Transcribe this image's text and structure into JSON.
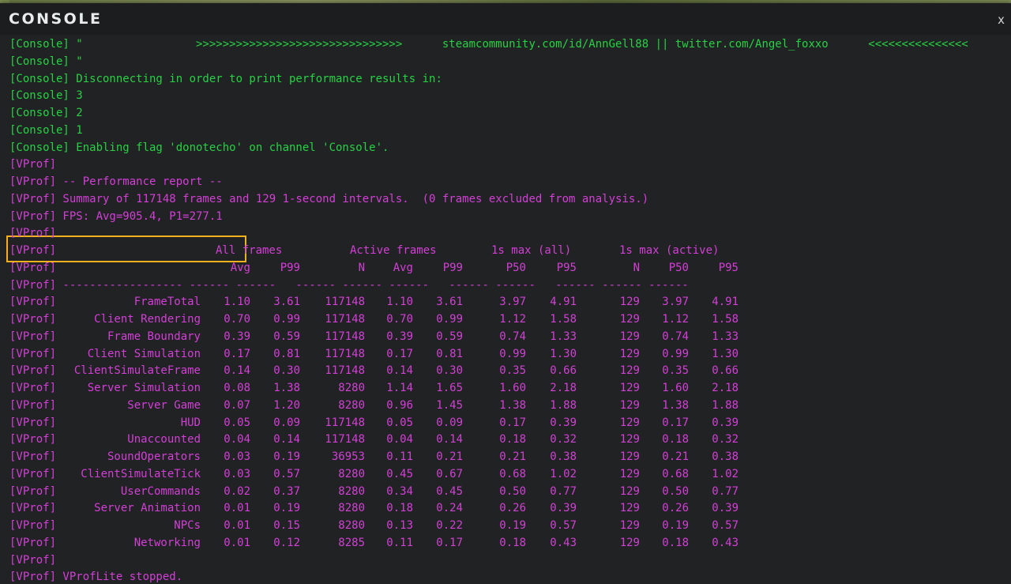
{
  "window": {
    "title": "CONSOLE",
    "close_label": "x"
  },
  "green_lines": [
    "[Console] \"                 >>>>>>>>>>>>>>>>>>>>>>>>>>>>>>>      steamcommunity.com/id/AnnGell88 || twitter.com/Angel_foxxo      <<<<<<<<<<<<<<<",
    "[Console] \"",
    "[Console] Disconnecting in order to print performance results in:",
    "[Console] 3",
    "[Console] 2",
    "[Console] 1",
    "[Console] Enabling flag 'donotecho' on channel 'Console'."
  ],
  "vprof_prefix": "[VProf]",
  "report_header": "[VProf] -- Performance report --",
  "summary_line": "[VProf] Summary of 117148 frames and 129 1-second intervals.  (0 frames excluded from analysis.)",
  "fps_line": "[VProf] FPS: Avg=905.4, P1=277.1",
  "group_headers": [
    "All frames",
    "Active frames",
    "1s max (all)",
    "1s max (active)"
  ],
  "column_headers": [
    "Avg",
    "P99",
    "N",
    "Avg",
    "P99",
    "P50",
    "P95",
    "N",
    "P50",
    "P95"
  ],
  "separator_line": "[VProf] ------------------ ------ ------   ------ ------ ------   ------ ------   ------ ------ ------",
  "rows": [
    {
      "name": "FrameTotal",
      "v": [
        "1.10",
        "3.61",
        "117148",
        "1.10",
        "3.61",
        "3.97",
        "4.91",
        "129",
        "3.97",
        "4.91"
      ]
    },
    {
      "name": "Client Rendering",
      "v": [
        "0.70",
        "0.99",
        "117148",
        "0.70",
        "0.99",
        "1.12",
        "1.58",
        "129",
        "1.12",
        "1.58"
      ]
    },
    {
      "name": "Frame Boundary",
      "v": [
        "0.39",
        "0.59",
        "117148",
        "0.39",
        "0.59",
        "0.74",
        "1.33",
        "129",
        "0.74",
        "1.33"
      ]
    },
    {
      "name": "Client Simulation",
      "v": [
        "0.17",
        "0.81",
        "117148",
        "0.17",
        "0.81",
        "0.99",
        "1.30",
        "129",
        "0.99",
        "1.30"
      ]
    },
    {
      "name": "ClientSimulateFrame",
      "v": [
        "0.14",
        "0.30",
        "117148",
        "0.14",
        "0.30",
        "0.35",
        "0.66",
        "129",
        "0.35",
        "0.66"
      ]
    },
    {
      "name": "Server Simulation",
      "v": [
        "0.08",
        "1.38",
        "8280",
        "1.14",
        "1.65",
        "1.60",
        "2.18",
        "129",
        "1.60",
        "2.18"
      ]
    },
    {
      "name": "Server Game",
      "v": [
        "0.07",
        "1.20",
        "8280",
        "0.96",
        "1.45",
        "1.38",
        "1.88",
        "129",
        "1.38",
        "1.88"
      ]
    },
    {
      "name": "HUD",
      "v": [
        "0.05",
        "0.09",
        "117148",
        "0.05",
        "0.09",
        "0.17",
        "0.39",
        "129",
        "0.17",
        "0.39"
      ]
    },
    {
      "name": "Unaccounted",
      "v": [
        "0.04",
        "0.14",
        "117148",
        "0.04",
        "0.14",
        "0.18",
        "0.32",
        "129",
        "0.18",
        "0.32"
      ]
    },
    {
      "name": "SoundOperators",
      "v": [
        "0.03",
        "0.19",
        "36953",
        "0.11",
        "0.21",
        "0.21",
        "0.38",
        "129",
        "0.21",
        "0.38"
      ]
    },
    {
      "name": "ClientSimulateTick",
      "v": [
        "0.03",
        "0.57",
        "8280",
        "0.45",
        "0.67",
        "0.68",
        "1.02",
        "129",
        "0.68",
        "1.02"
      ]
    },
    {
      "name": "UserCommands",
      "v": [
        "0.02",
        "0.37",
        "8280",
        "0.34",
        "0.45",
        "0.50",
        "0.77",
        "129",
        "0.50",
        "0.77"
      ]
    },
    {
      "name": "Server Animation",
      "v": [
        "0.01",
        "0.19",
        "8280",
        "0.18",
        "0.24",
        "0.26",
        "0.39",
        "129",
        "0.26",
        "0.39"
      ]
    },
    {
      "name": "NPCs",
      "v": [
        "0.01",
        "0.15",
        "8280",
        "0.13",
        "0.22",
        "0.19",
        "0.57",
        "129",
        "0.19",
        "0.57"
      ]
    },
    {
      "name": "Networking",
      "v": [
        "0.01",
        "0.12",
        "8285",
        "0.11",
        "0.17",
        "0.18",
        "0.43",
        "129",
        "0.18",
        "0.43"
      ]
    }
  ],
  "final_line": "[VProf] VProfLite stopped.",
  "colors": {
    "console_green": "#27d244",
    "vprof_magenta": "#d43fd8",
    "highlight": "#f0b11c",
    "background": "#202223"
  }
}
